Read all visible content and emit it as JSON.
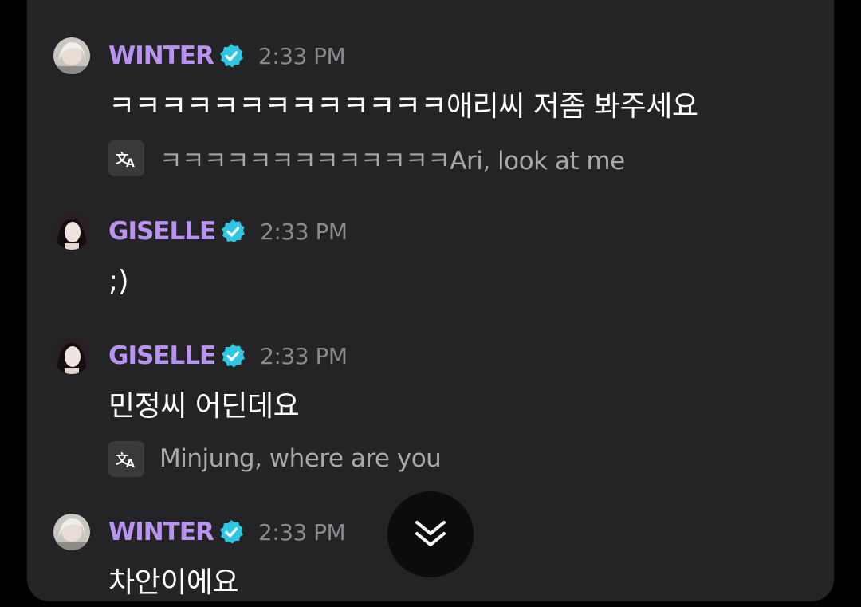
{
  "messages": [
    {
      "author": "WINTER",
      "time": "2:33 PM",
      "text": "ㅋㅋㅋㅋㅋㅋㅋㅋㅋㅋㅋㅋㅋ애리씨 저좀 봐주세요",
      "translation": "ㅋㅋㅋㅋㅋㅋㅋㅋㅋㅋㅋㅋㅋAri, look at me"
    },
    {
      "author": "GISELLE",
      "time": "2:33 PM",
      "text": ";)"
    },
    {
      "author": "GISELLE",
      "time": "2:33 PM",
      "text": "민정씨 어딘데요",
      "translation": "Minjung, where are you"
    },
    {
      "author": "WINTER",
      "time": "2:33 PM",
      "text": "차안이에요"
    }
  ],
  "icons": {
    "verified": "verified-badge-icon",
    "translate": "translate-icon",
    "scroll": "double-chevron-down-icon"
  },
  "colors": {
    "panel_bg": "#242325",
    "author_name": "#b993f0",
    "verified_badge": "#2fc6e3",
    "timestamp": "#8a898d",
    "translation_text": "#a9a8ac"
  }
}
